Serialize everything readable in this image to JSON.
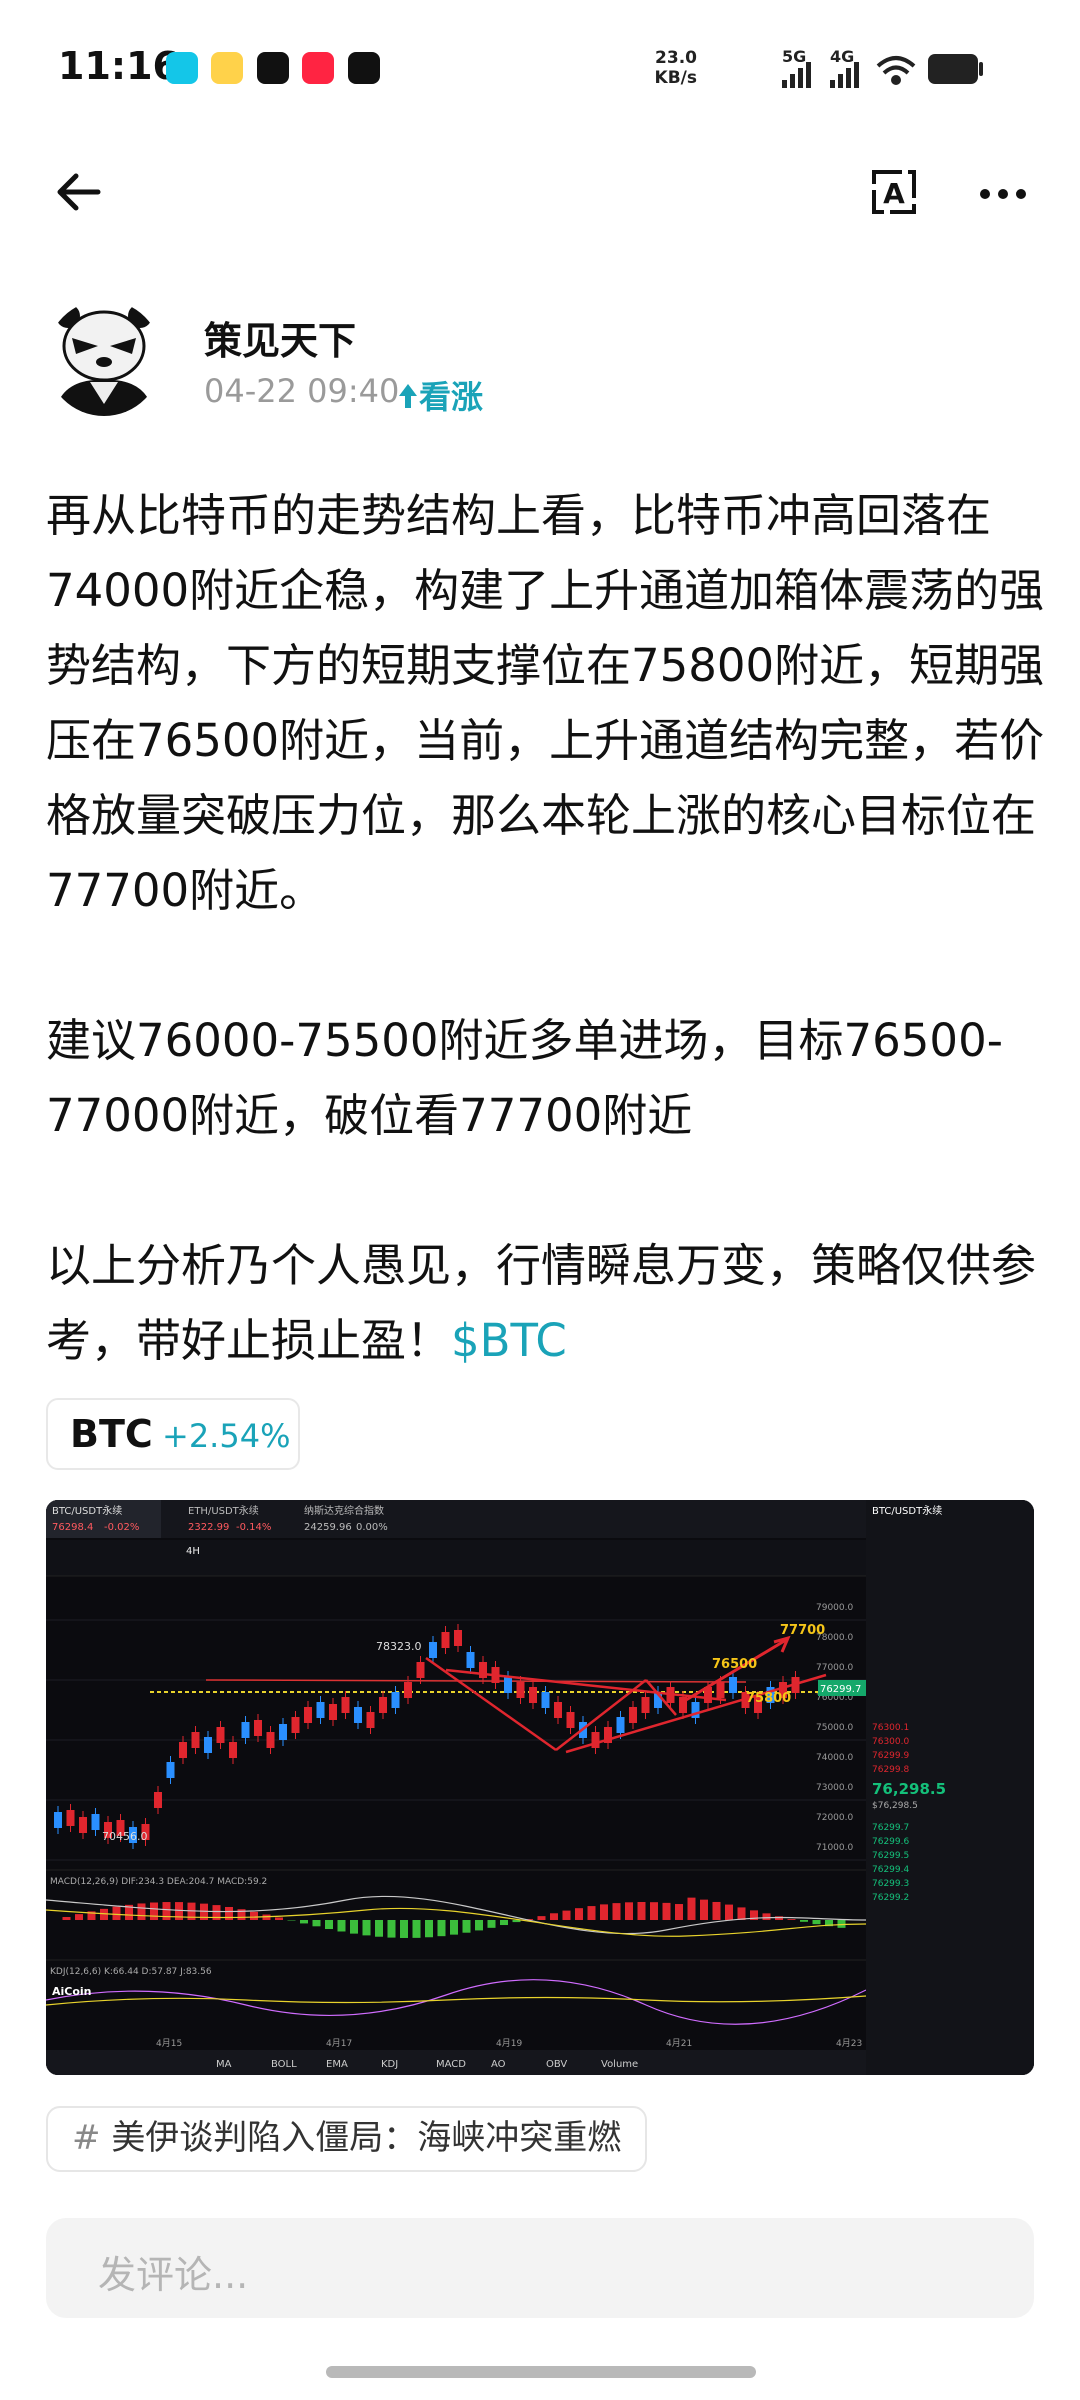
{
  "status": {
    "time": "11:16",
    "net_speed_value": "23.0",
    "net_speed_unit": "KB/s",
    "signal1": "5G",
    "signal2": "4G",
    "app_icons": [
      "lanxin-icon",
      "weibo-icon",
      "capcut-icon",
      "xiaohongshu-icon",
      "tiktok-icon"
    ]
  },
  "header": {
    "back_icon": "back-arrow-icon",
    "translate_icon": "translate-icon",
    "more_icon": "more-icon"
  },
  "author": {
    "name": "策见天下",
    "time": "04-22 09:40",
    "sentiment": "看涨"
  },
  "post": {
    "para1": "再从比特币的走势结构上看，比特币冲高回落在74000附近企稳，构建了上升通道加箱体震荡的强势结构，下方的短期支撑位在75800附近，短期强压在76500附近，当前，上升通道结构完整，若价格放量突破压力位，那么本轮上涨的核心目标位在77700附近。",
    "para2": "建议76000-75500附近多单进场，目标76500-77000附近，破位看77700附近",
    "para3": "以上分析乃个人愚见，行情瞬息万变，策略仅供参考，带好止损止盈！",
    "cashtag": "$BTC"
  },
  "coin": {
    "symbol": "BTC",
    "change": "+2.54%"
  },
  "chart_image": {
    "tab1": "BTC/USDT永续",
    "tab1_price": "76298.4",
    "tab1_change": "-0.02%",
    "tab2": "ETH/USDT永续",
    "tab2_price": "2322.99",
    "tab2_change": "-0.14%",
    "tab3": "纳斯达克综合指数",
    "tab3_price": "24259.96",
    "tab3_change": "0.00%",
    "timeframe": "4H",
    "label_high": "78323.0",
    "label_low": "70456.0",
    "label_76500": "76500",
    "label_77700": "77700",
    "label_75800": "75800",
    "current_price": "76299.7",
    "y_ticks": [
      "79000.0",
      "78000.0",
      "77000.0",
      "76000.0",
      "75000.0",
      "74000.0",
      "73000.0",
      "72000.0",
      "71000.0"
    ],
    "x_ticks": [
      "4月15",
      "4月17",
      "4月19",
      "4月21",
      "4月23"
    ],
    "macd_label": "MACD(12,26,9) DIF:234.3 DEA:204.7 MACD:59.2",
    "kdj_label": "KDJ(12,6,6) K:66.44 D:57.87 J:83.56",
    "indicators": [
      "MA",
      "BOLL",
      "EMA",
      "KDJ",
      "MACD",
      "AO",
      "OBV",
      "Volume"
    ],
    "brand": "AiCoin",
    "side_title": "BTC/USDT永续",
    "side_big_price": "76,298.5",
    "side_small_price": "$76,298.5",
    "side_asks": [
      "76300.1",
      "76300.0",
      "76299.9",
      "76299.8"
    ],
    "side_bids": [
      "76299.7",
      "76299.6",
      "76299.5",
      "76299.4",
      "76299.3",
      "76299.2"
    ]
  },
  "topic": {
    "text": "美伊谈判陷入僵局：海峡冲突重燃"
  },
  "comment": {
    "placeholder": "发评论..."
  },
  "colors": {
    "accent": "#1aa3b8",
    "up": "#e0262e",
    "down": "#2a8fff"
  }
}
